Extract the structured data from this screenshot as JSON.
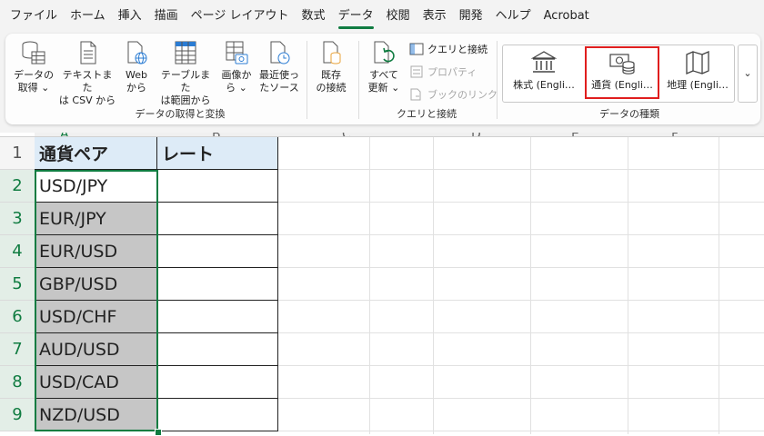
{
  "menu": {
    "items": [
      "ファイル",
      "ホーム",
      "挿入",
      "描画",
      "ページ レイアウト",
      "数式",
      "データ",
      "校閲",
      "表示",
      "開発",
      "ヘルプ",
      "Acrobat"
    ],
    "active_index": 6
  },
  "ribbon": {
    "get_transform": {
      "label": "データの取得と変換",
      "buttons": {
        "get_data": "データの\n取得 ⌄",
        "from_text_csv": "テキストまた\nは CSV から",
        "from_web": "Web\nから",
        "from_table": "テーブルまた\nは範囲から",
        "from_picture": "画像か\nら ⌄",
        "recent_sources": "最近使っ\nたソース",
        "existing_connections": "既存\nの接続"
      }
    },
    "queries": {
      "label": "クエリと接続",
      "refresh_all": "すべて\n更新 ⌄",
      "queries_connections": "クエリと接続",
      "properties": "プロパティ",
      "edit_links": "ブックのリンク"
    },
    "data_types": {
      "label": "データの種類",
      "stocks": "株式 (Engli…",
      "currencies": "通貨 (Engli…",
      "geography": "地理 (Engli…",
      "more": "⌄"
    }
  },
  "grid": {
    "columns": [
      "A",
      "B",
      "C",
      "D",
      "E",
      "F"
    ],
    "rows": [
      "1",
      "2",
      "3",
      "4",
      "5",
      "6",
      "7",
      "8",
      "9"
    ],
    "header": [
      "通貨ペア",
      "レート"
    ],
    "pairs": [
      "USD/JPY",
      "EUR/JPY",
      "EUR/USD",
      "GBP/USD",
      "USD/CHF",
      "AUD/USD",
      "USD/CAD",
      "NZD/USD"
    ]
  },
  "colors": {
    "accent": "#107c41",
    "header_fill": "#ddebf7",
    "selection_fill": "#c6c6c6",
    "highlight_border": "#e01e1e"
  }
}
